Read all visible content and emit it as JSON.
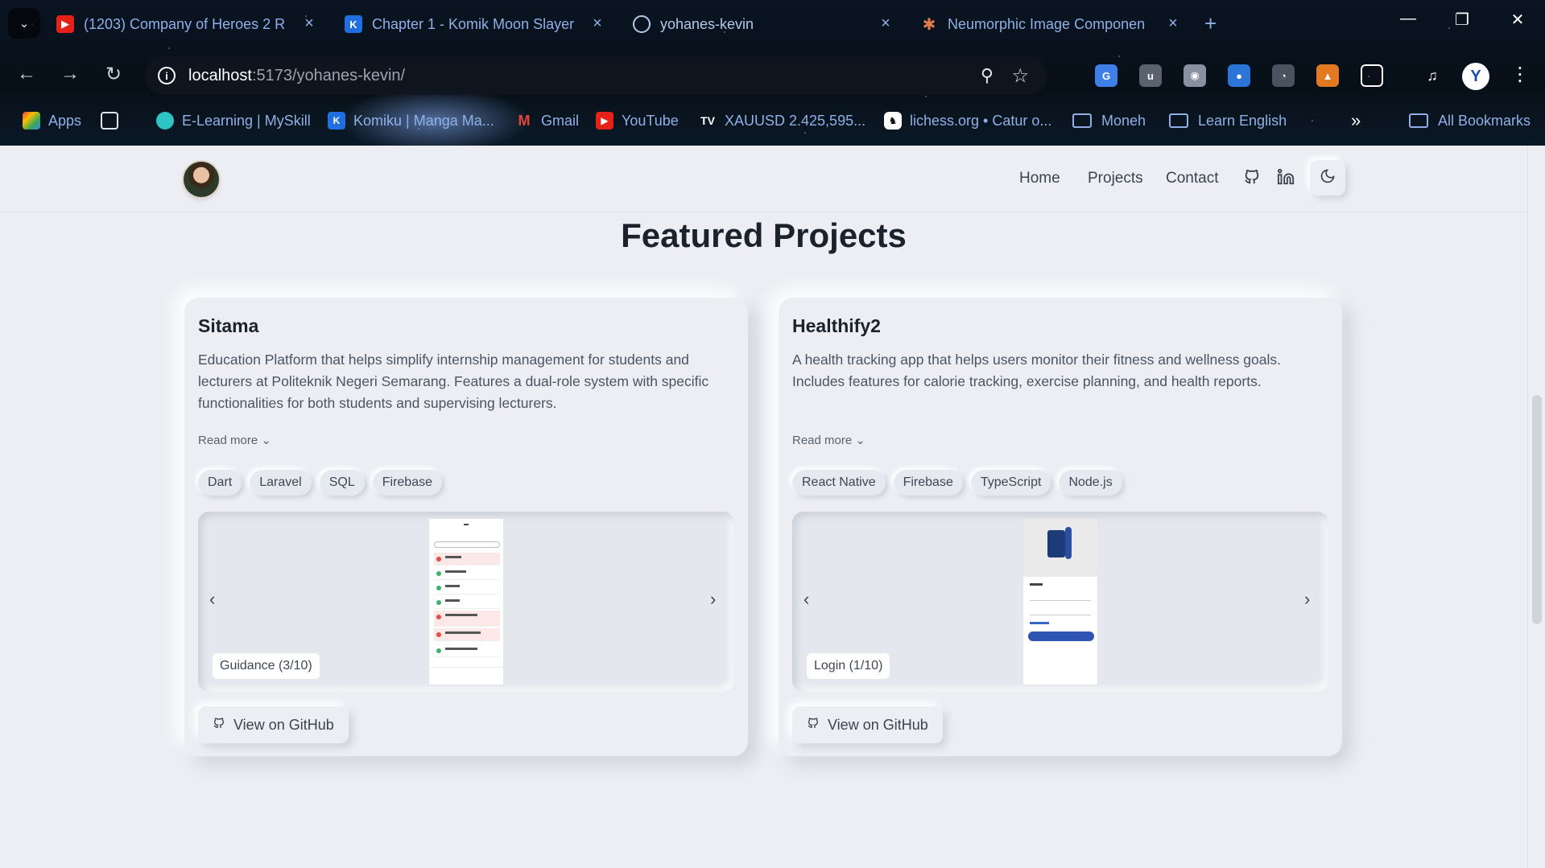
{
  "browser": {
    "tabs": [
      {
        "title": "(1203) Company of Heroes 2 R",
        "favicon": "youtube-icon"
      },
      {
        "title": "Chapter 1 - Komik Moon Slayer",
        "favicon": "komiku-icon"
      },
      {
        "title": "yohanes-kevin",
        "favicon": "globe-icon"
      },
      {
        "title": "Neumorphic Image Componen",
        "favicon": "claude-icon"
      }
    ],
    "url_host": "localhost",
    "url_rest": ":5173/yohanes-kevin/",
    "profile_initial": "Y",
    "bookmarks": [
      {
        "label": "Apps"
      },
      {
        "label": ""
      },
      {
        "label": "E-Learning | MySkill"
      },
      {
        "label": "Komiku | Manga Ma..."
      },
      {
        "label": "Gmail"
      },
      {
        "label": "YouTube"
      },
      {
        "label": "XAUUSD 2.425,595..."
      },
      {
        "label": "lichess.org • Catur o..."
      },
      {
        "label": "Moneh"
      },
      {
        "label": "Learn English"
      },
      {
        "label": "All Bookmarks"
      }
    ]
  },
  "site": {
    "nav": {
      "home": "Home",
      "projects": "Projects",
      "contact": "Contact"
    },
    "section_title": "Featured Projects",
    "projects": [
      {
        "title": "Sitama",
        "description": "Education Platform that helps simplify internship management for students and lecturers at Politeknik Negeri Semarang. Features a dual-role system with specific functionalities for both students and supervising lecturers.",
        "read_more": "Read more",
        "tags": [
          "Dart",
          "Laravel",
          "SQL",
          "Firebase"
        ],
        "caption": "Guidance (3/10)",
        "github_label": "View on GitHub"
      },
      {
        "title": "Healthify2",
        "description": "A health tracking app that helps users monitor their fitness and wellness goals. Includes features for calorie tracking, exercise planning, and health reports.",
        "read_more": "Read more",
        "tags": [
          "React Native",
          "Firebase",
          "TypeScript",
          "Node.js"
        ],
        "caption": "Login (1/10)",
        "github_label": "View on GitHub"
      }
    ]
  },
  "colors": {
    "page_bg": "#eceef3",
    "heading": "#1c222c",
    "accent_blue": "#1a4fb0"
  }
}
